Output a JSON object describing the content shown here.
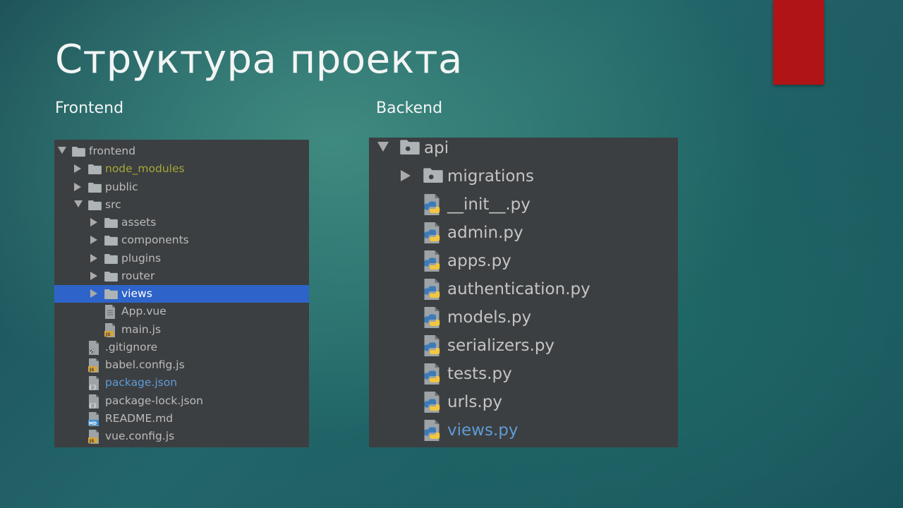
{
  "slide": {
    "title": "Структура проекта",
    "frontend_label": "Frontend",
    "backend_label": "Backend",
    "accent_color": "#b11416"
  },
  "frontend_tree": [
    {
      "label": "frontend",
      "type": "folder",
      "expanded": true,
      "depth": 0
    },
    {
      "label": "node_modules",
      "type": "folder",
      "expanded": false,
      "depth": 1,
      "color": "#a5a836"
    },
    {
      "label": "public",
      "type": "folder",
      "expanded": false,
      "depth": 1
    },
    {
      "label": "src",
      "type": "folder",
      "expanded": true,
      "depth": 1
    },
    {
      "label": "assets",
      "type": "folder",
      "expanded": false,
      "depth": 2
    },
    {
      "label": "components",
      "type": "folder",
      "expanded": false,
      "depth": 2
    },
    {
      "label": "plugins",
      "type": "folder",
      "expanded": false,
      "depth": 2
    },
    {
      "label": "router",
      "type": "folder",
      "expanded": false,
      "depth": 2
    },
    {
      "label": "views",
      "type": "folder",
      "expanded": false,
      "depth": 2,
      "selected": true
    },
    {
      "label": "App.vue",
      "type": "file",
      "icon": "vue-file-icon",
      "depth": 2
    },
    {
      "label": "main.js",
      "type": "file",
      "icon": "js-file-icon",
      "depth": 2
    },
    {
      "label": ".gitignore",
      "type": "file",
      "icon": "gitignore-file-icon",
      "depth": 1
    },
    {
      "label": "babel.config.js",
      "type": "file",
      "icon": "js-file-icon",
      "depth": 1
    },
    {
      "label": "package.json",
      "type": "file",
      "icon": "json-file-icon",
      "depth": 1,
      "color": "#5e9bd6"
    },
    {
      "label": "package-lock.json",
      "type": "file",
      "icon": "json-file-icon",
      "depth": 1
    },
    {
      "label": "README.md",
      "type": "file",
      "icon": "markdown-file-icon",
      "depth": 1
    },
    {
      "label": "vue.config.js",
      "type": "file",
      "icon": "js-file-icon",
      "depth": 1
    }
  ],
  "backend_tree": [
    {
      "label": "api",
      "type": "folder",
      "expanded": true,
      "depth": 0
    },
    {
      "label": "migrations",
      "type": "folder",
      "expanded": false,
      "depth": 1
    },
    {
      "label": "__init__.py",
      "type": "file",
      "icon": "python-file-icon",
      "depth": 1
    },
    {
      "label": "admin.py",
      "type": "file",
      "icon": "python-file-icon",
      "depth": 1
    },
    {
      "label": "apps.py",
      "type": "file",
      "icon": "python-file-icon",
      "depth": 1
    },
    {
      "label": "authentication.py",
      "type": "file",
      "icon": "python-file-icon",
      "depth": 1
    },
    {
      "label": "models.py",
      "type": "file",
      "icon": "python-file-icon",
      "depth": 1
    },
    {
      "label": "serializers.py",
      "type": "file",
      "icon": "python-file-icon",
      "depth": 1
    },
    {
      "label": "tests.py",
      "type": "file",
      "icon": "python-file-icon",
      "depth": 1
    },
    {
      "label": "urls.py",
      "type": "file",
      "icon": "python-file-icon",
      "depth": 1
    },
    {
      "label": "views.py",
      "type": "file",
      "icon": "python-file-icon",
      "depth": 1,
      "color": "#5e9bd6"
    }
  ]
}
